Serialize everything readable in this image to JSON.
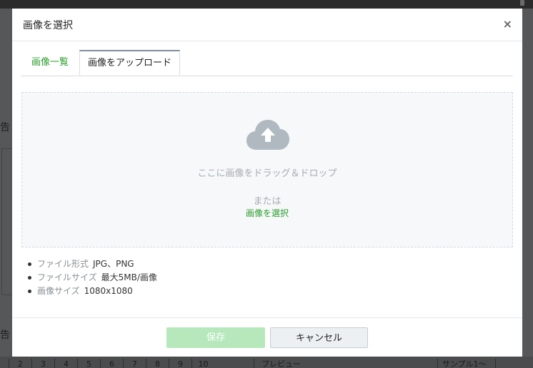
{
  "background": {
    "char_top": "告",
    "char_bottom": "告",
    "pager": [
      "2",
      "3",
      "4",
      "5",
      "6",
      "7",
      "8",
      "9",
      "10"
    ],
    "preview_label": "プレビュー",
    "sample_label": "サンプル1～"
  },
  "modal": {
    "title": "画像を選択",
    "close": "×",
    "tabs": [
      {
        "label": "画像一覧",
        "active": false
      },
      {
        "label": "画像をアップロード",
        "active": true
      }
    ],
    "dropzone": {
      "icon": "cloud-upload-icon",
      "text": "ここに画像をドラッグ＆ドロップ",
      "or": "または",
      "select_link": "画像を選択"
    },
    "notes": [
      {
        "key": "ファイル形式",
        "value": "JPG、PNG"
      },
      {
        "key": "ファイルサイズ",
        "value": "最大5MB/画像"
      },
      {
        "key": "画像サイズ",
        "value": "1080x1080"
      }
    ],
    "footer": {
      "save_label": "保存",
      "cancel_label": "キャンセル"
    }
  },
  "colors": {
    "accent_green": "#2a9d2a",
    "save_disabled": "#b7e8bc",
    "cloud_icon": "#b0b8c0"
  }
}
